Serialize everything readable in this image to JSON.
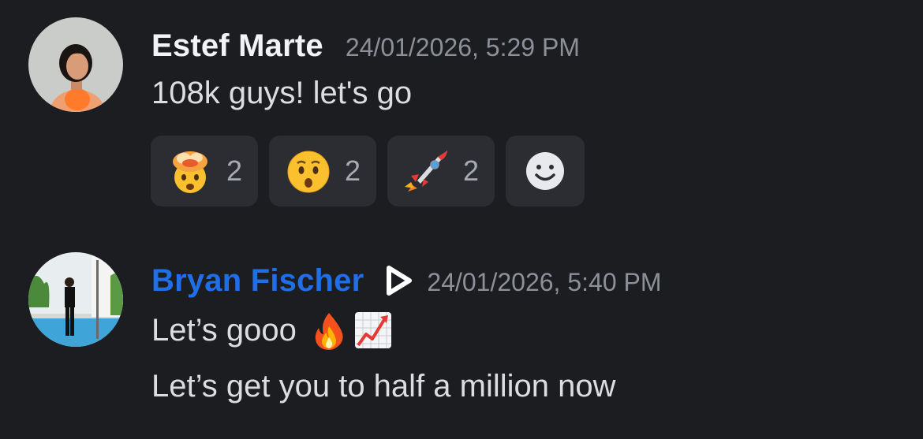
{
  "messages": [
    {
      "author": "Estef Marte",
      "timestamp": "24/01/2026, 5:29 PM",
      "lines": [
        "108k guys! let's go"
      ],
      "reactions": [
        {
          "emoji": "exploding-head-emoji",
          "count": "2"
        },
        {
          "emoji": "hushed-face-emoji",
          "count": "2"
        },
        {
          "emoji": "rocket-emoji",
          "count": "2"
        }
      ],
      "add_reaction_icon": "add-reaction-smiley-icon"
    },
    {
      "author": "Bryan Fischer",
      "author_color": "#1f6fe8",
      "badge_icon": "play-badge-icon",
      "timestamp": "24/01/2026, 5:40 PM",
      "lines": [
        "Let’s gooo",
        "Let’s get you to half a million now"
      ],
      "inline_emojis": [
        "fire-emoji",
        "chart-increasing-emoji"
      ]
    }
  ],
  "colors": {
    "background": "#1c1d21",
    "reaction_bg": "#2c2d33",
    "timestamp": "#8e9099",
    "text": "#dcdde1"
  }
}
